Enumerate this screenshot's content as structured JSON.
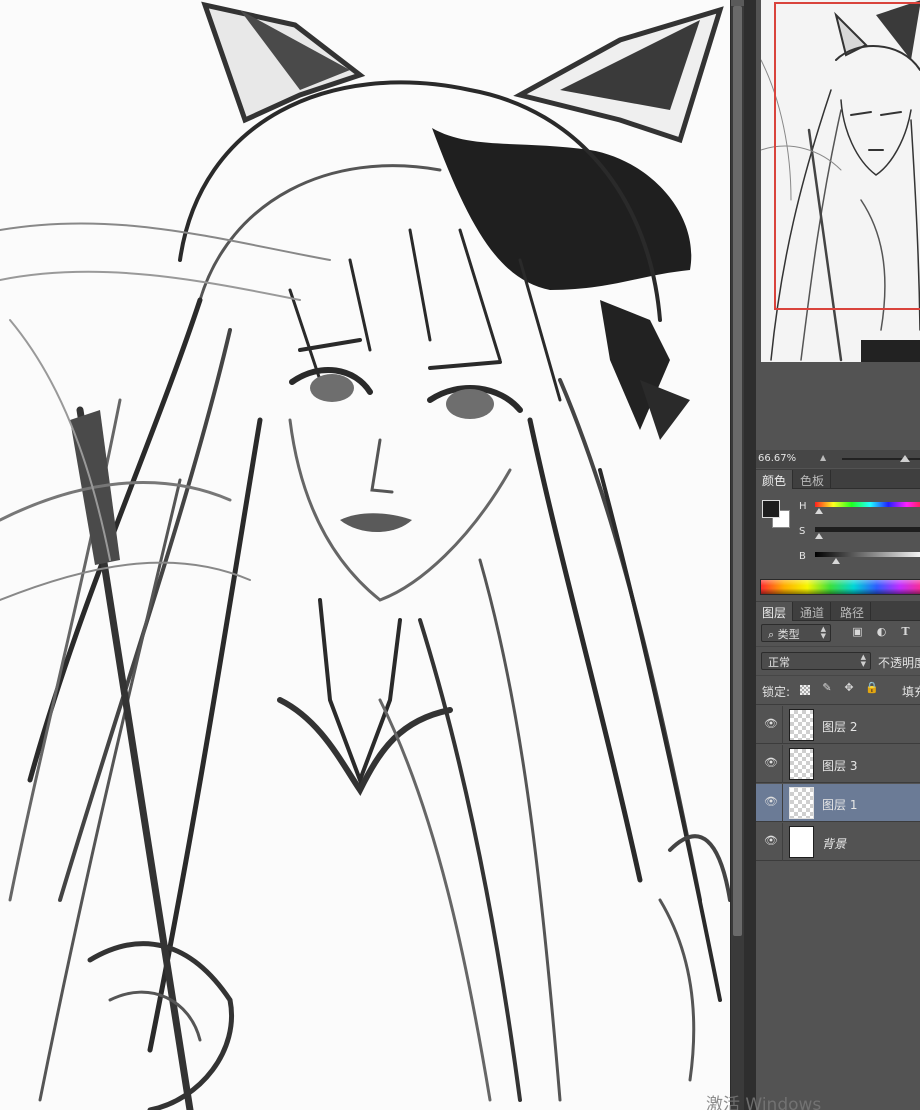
{
  "navigator": {
    "zoom": "66.67%"
  },
  "color_panel": {
    "tabs": [
      {
        "label": "颜色",
        "active": true
      },
      {
        "label": "色板",
        "active": false
      }
    ],
    "channels": [
      "H",
      "S",
      "B"
    ],
    "foreground_color": "#1e1e1e",
    "background_color": "#ffffff"
  },
  "layers_panel": {
    "tabs": [
      {
        "label": "图层",
        "active": true
      },
      {
        "label": "通道",
        "active": false
      },
      {
        "label": "路径",
        "active": false
      }
    ],
    "filter_label": "类型",
    "blend_mode": "正常",
    "opacity_label": "不透明度",
    "lock_label": "锁定:",
    "fill_label": "填充",
    "layers": [
      {
        "name": "图层 2",
        "visible": true,
        "selected": false
      },
      {
        "name": "图层 3",
        "visible": true,
        "selected": false
      },
      {
        "name": "图层 1",
        "visible": true,
        "selected": true
      },
      {
        "name": "背景",
        "visible": true,
        "selected": false
      }
    ]
  },
  "watermark": "激活 Windows"
}
